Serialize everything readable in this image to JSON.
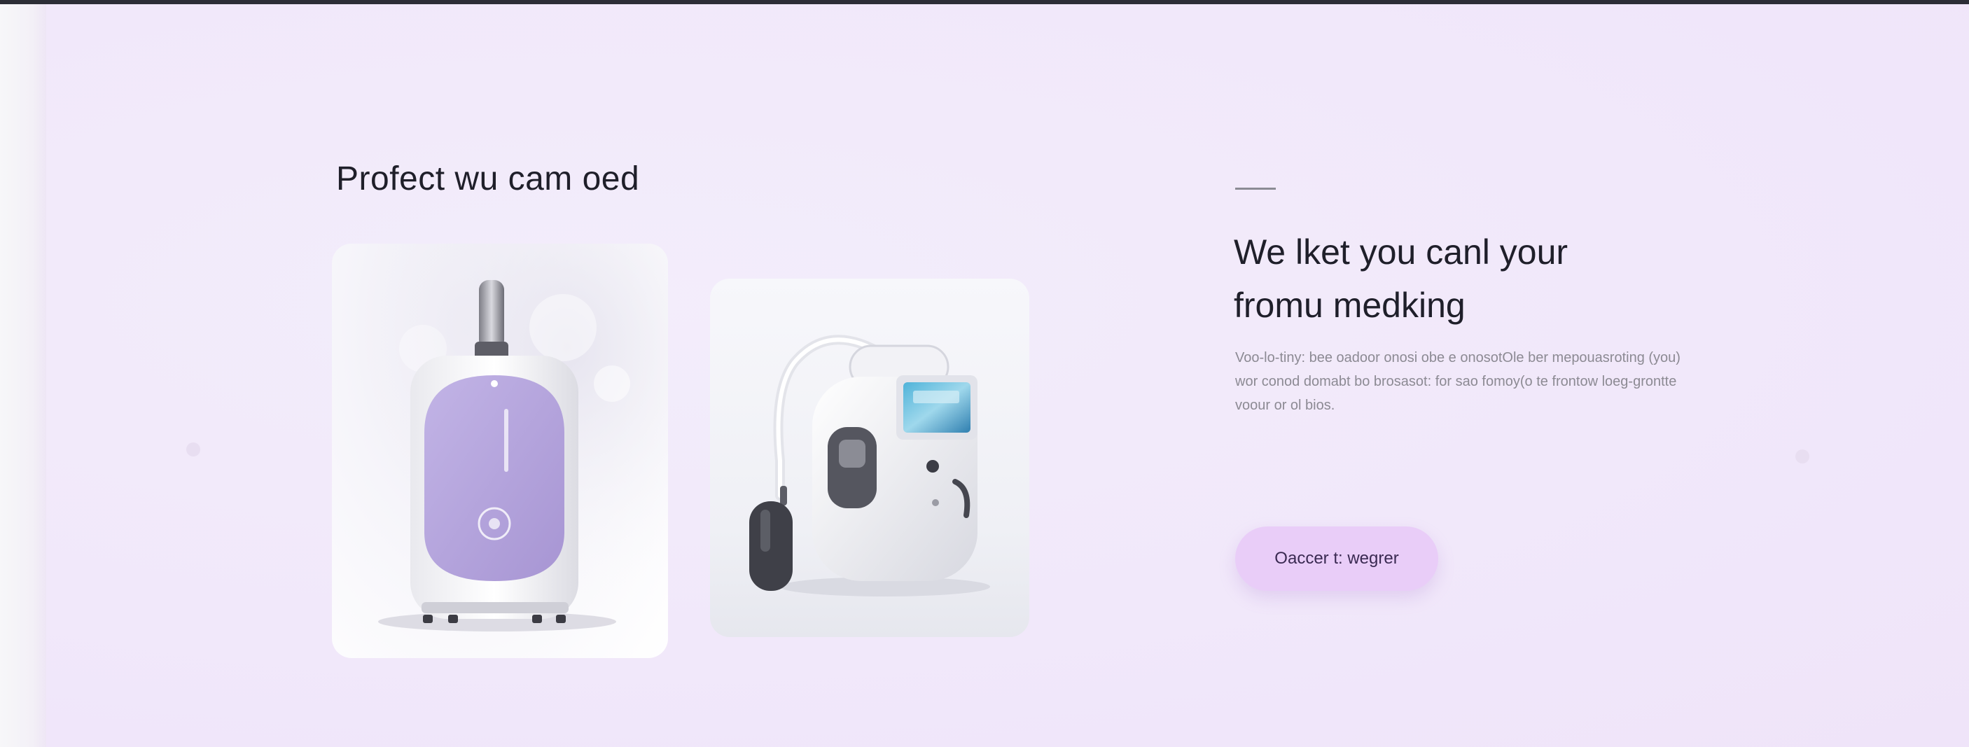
{
  "left_column": {
    "heading": "Profect wu cam oed"
  },
  "right_column": {
    "heading_line1": "We lket you canl your",
    "heading_line2": "fromu medking",
    "description": "Voo-lo-tiny: bee oadoor onosi obe e onosotOle ber mepouasroting (you) wor conod domabt bo brosasot: for sao fomoy(o te frontow loeg-grontte voour or ol bios.",
    "cta_label": "Oaccer t: wegrer"
  },
  "colors": {
    "background": "#f4ecfa",
    "accent": "#e9cdf8",
    "device_purple": "#b7a7df",
    "heading_text": "#1f1f2a",
    "body_text": "#8c8a93"
  }
}
